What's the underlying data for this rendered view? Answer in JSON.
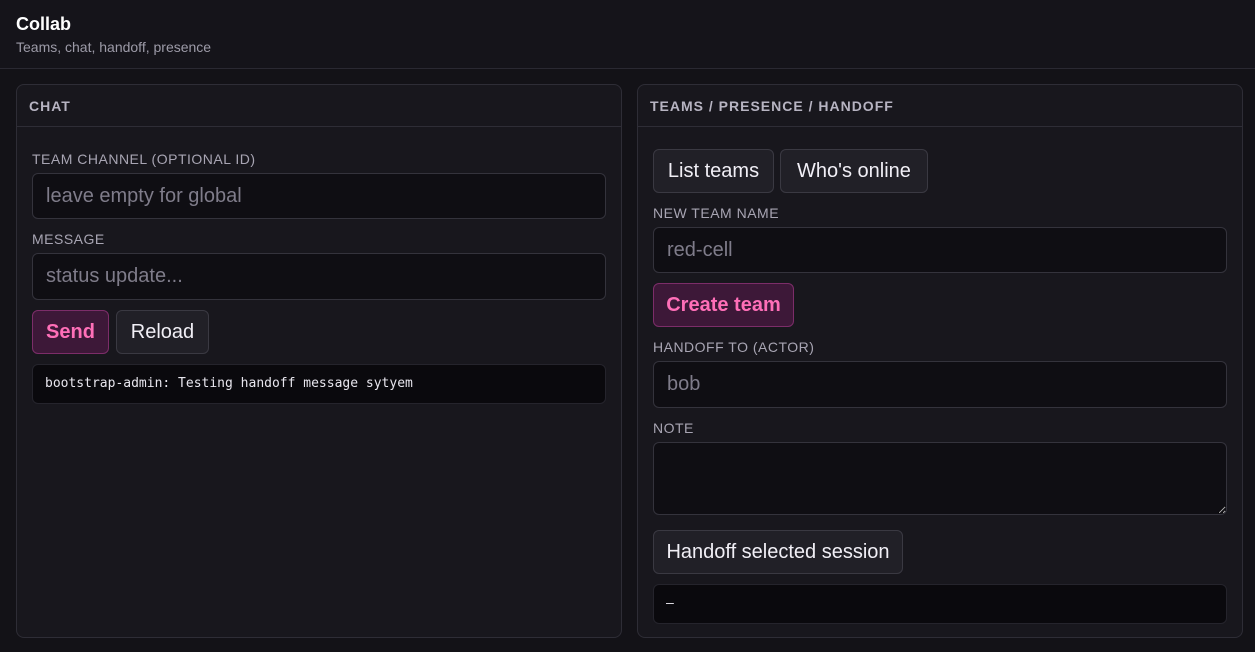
{
  "app": {
    "title": "Collab",
    "subtitle": "Teams, chat, handoff, presence"
  },
  "chat": {
    "header": "CHAT",
    "channel_label": "TEAM CHANNEL (OPTIONAL ID)",
    "channel_placeholder": "leave empty for global",
    "channel_value": "",
    "message_label": "MESSAGE",
    "message_placeholder": "status update...",
    "message_value": "",
    "send_label": "Send",
    "reload_label": "Reload",
    "log": "bootstrap-admin: Testing handoff message sytyem"
  },
  "teams": {
    "header": "TEAMS / PRESENCE / HANDOFF",
    "list_teams_label": "List teams",
    "whos_online_label": "Who's online",
    "new_team_label": "NEW TEAM NAME",
    "new_team_placeholder": "red-cell",
    "create_team_label": "Create team",
    "handoff_to_label": "HANDOFF TO (ACTOR)",
    "handoff_to_placeholder": "bob",
    "note_label": "NOTE",
    "note_placeholder": "",
    "handoff_button_label": "Handoff selected session",
    "output": "–"
  },
  "colors": {
    "background": "#131217",
    "panel": "#18171d",
    "accent": "#ff6fb8",
    "accent_bg": "#3d1838"
  }
}
